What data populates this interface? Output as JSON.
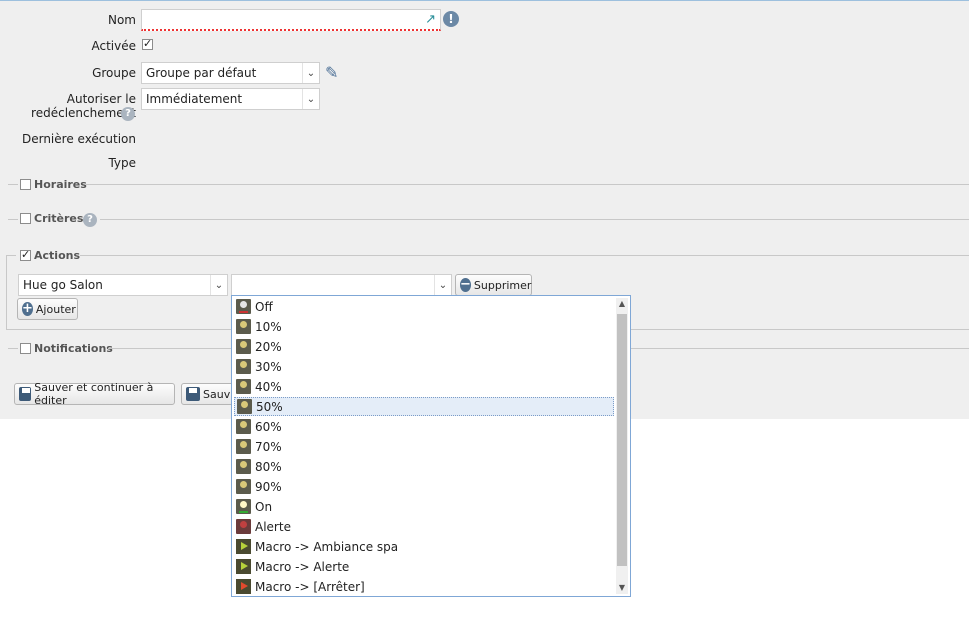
{
  "form": {
    "nom_label": "Nom",
    "nom_value": "",
    "activee_label": "Activée",
    "groupe_label": "Groupe",
    "groupe_value": "Groupe par défaut",
    "autoriser_label_line1": "Autoriser le",
    "autoriser_label_line2": "redéclenchement",
    "autoriser_value": "Immédiatement",
    "derniere_label": "Dernière exécution",
    "type_label": "Type",
    "help_glyph": "?",
    "warning_glyph": "!"
  },
  "sections": {
    "horaires": "Horaires",
    "criteres": "Critères",
    "actions": "Actions",
    "notifications": "Notifications"
  },
  "actions": {
    "device_value": "Hue go Salon",
    "action_value": "",
    "delete_label": "Supprimer",
    "add_label": "Ajouter"
  },
  "buttons": {
    "save_continue": "Sauver et continuer à éditer",
    "save_partial": "Sauv"
  },
  "dropdown": {
    "selected_index": 5,
    "items": [
      {
        "label": "Off",
        "icon": "bulb-off-icon"
      },
      {
        "label": "10%",
        "icon": "bulb-icon"
      },
      {
        "label": "20%",
        "icon": "bulb-icon"
      },
      {
        "label": "30%",
        "icon": "bulb-icon"
      },
      {
        "label": "40%",
        "icon": "bulb-icon"
      },
      {
        "label": "50%",
        "icon": "bulb-icon"
      },
      {
        "label": "60%",
        "icon": "bulb-icon"
      },
      {
        "label": "70%",
        "icon": "bulb-icon"
      },
      {
        "label": "80%",
        "icon": "bulb-icon"
      },
      {
        "label": "90%",
        "icon": "bulb-icon"
      },
      {
        "label": "On",
        "icon": "bulb-on-icon"
      },
      {
        "label": "Alerte",
        "icon": "alert-icon"
      },
      {
        "label": "Macro -> Ambiance spa",
        "icon": "play-icon"
      },
      {
        "label": "Macro -> Alerte",
        "icon": "play-icon"
      },
      {
        "label": "Macro -> [Arrêter]",
        "icon": "stop-macro-icon"
      }
    ]
  },
  "colors": {
    "panel_bg": "#efefef",
    "accent": "#7fa7d6",
    "selected_bg": "#e4edf8"
  }
}
